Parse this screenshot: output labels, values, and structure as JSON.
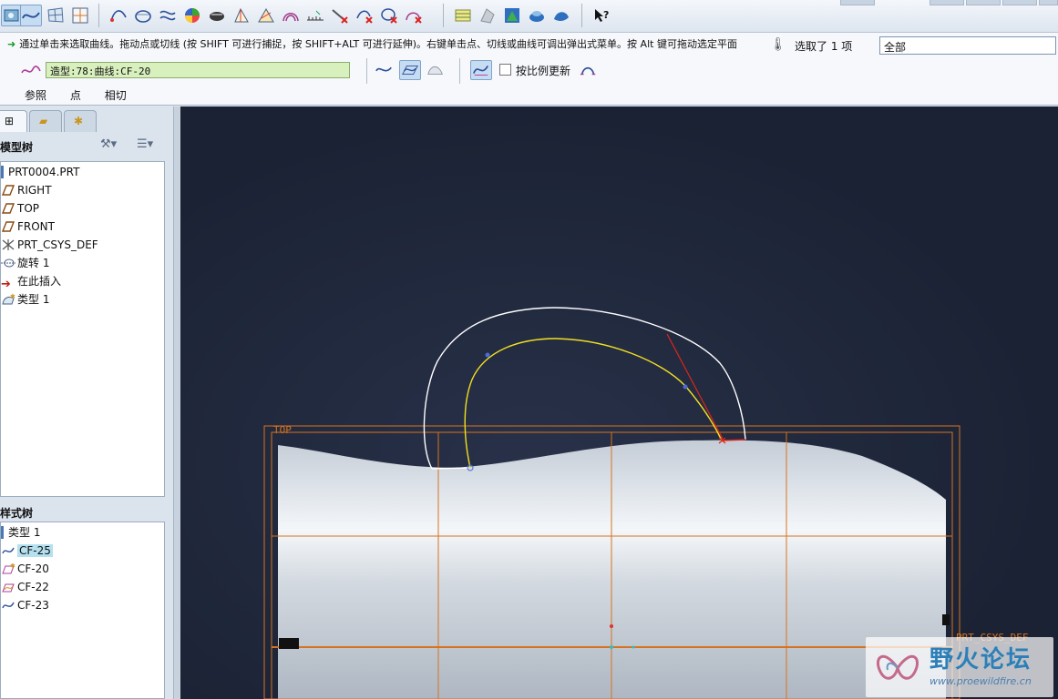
{
  "dashboard": {
    "message": "通过单击来选取曲线。拖动点或切线 (按 SHIFT 可进行捕捉，按 SHIFT+ALT 可进行延伸)。右键单击点、切线或曲线可调出弹出式菜单。按 Alt 键可拖动选定平面",
    "selected_status": "选取了 1 项",
    "filter_value": "全部",
    "curve_field": "造型:78:曲线:CF-20",
    "proportional_update_label": "按比例更新",
    "tabs": [
      "参照",
      "点",
      "相切"
    ]
  },
  "model_tree": {
    "title": "模型树",
    "items": [
      "PRT0004.PRT",
      "RIGHT",
      "TOP",
      "FRONT",
      "PRT_CSYS_DEF",
      "旋转 1",
      "在此插入",
      "类型 1"
    ]
  },
  "style_tree": {
    "title": "样式树",
    "items": [
      "类型 1",
      "CF-25",
      "CF-20",
      "CF-22",
      "CF-23"
    ]
  },
  "viewport": {
    "top_label": "TOP",
    "csys_label": "PRT_CSYS_DEF",
    "watermark_title": "野火论坛",
    "watermark_url": "www.proewildfire.cn"
  },
  "colors": {
    "datum_orange": "#d7731f",
    "active_curve_yellow": "#f2e020",
    "offset_curve_white": "#ffffff",
    "tangent_red": "#e0241a",
    "point_blue": "#4a6bd8"
  },
  "icons": {
    "message_arrow": "green-arrow-icon",
    "curve_type": "wave-curve-icon",
    "help": "what-is-this-icon"
  }
}
